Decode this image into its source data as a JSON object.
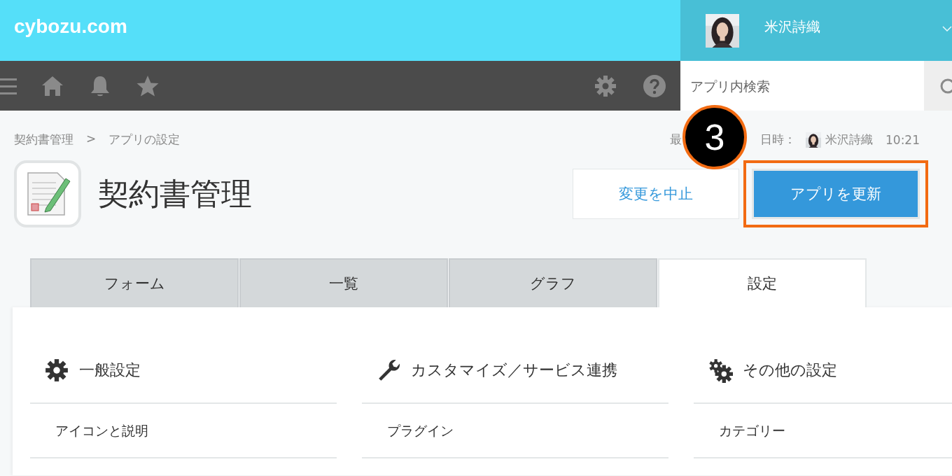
{
  "header": {
    "logo": "cybozu.com",
    "user": {
      "name": "米沢詩織"
    }
  },
  "toolbar": {
    "search": {
      "placeholder": "アプリ内検索"
    }
  },
  "breadcrumb": [
    {
      "label": "契約書管理"
    },
    {
      "label": ">"
    },
    {
      "label": "アプリの設定"
    }
  ],
  "updated": {
    "label_before": "最",
    "label_after": "日時：",
    "user": "米沢詩織",
    "time": "10:21"
  },
  "callout": {
    "number": "3"
  },
  "app": {
    "title": "契約書管理"
  },
  "buttons": [
    {
      "kind": "secondary",
      "label": "変更を中止",
      "highlighted": false
    },
    {
      "kind": "primary",
      "label": "アプリを更新",
      "highlighted": true
    }
  ],
  "tabs": [
    {
      "label": "フォーム",
      "selected": false
    },
    {
      "label": "一覧",
      "selected": false
    },
    {
      "label": "グラフ",
      "selected": false
    },
    {
      "label": "設定",
      "selected": true
    }
  ],
  "sections": [
    {
      "kind": "gear",
      "title": "一般設定",
      "items": [
        "アイコンと説明"
      ]
    },
    {
      "kind": "wrench",
      "title": "カスタマイズ／サービス連携",
      "items": [
        "プラグイン"
      ]
    },
    {
      "kind": "gears",
      "title": "その他の設定",
      "items": [
        "カテゴリー"
      ]
    }
  ]
}
